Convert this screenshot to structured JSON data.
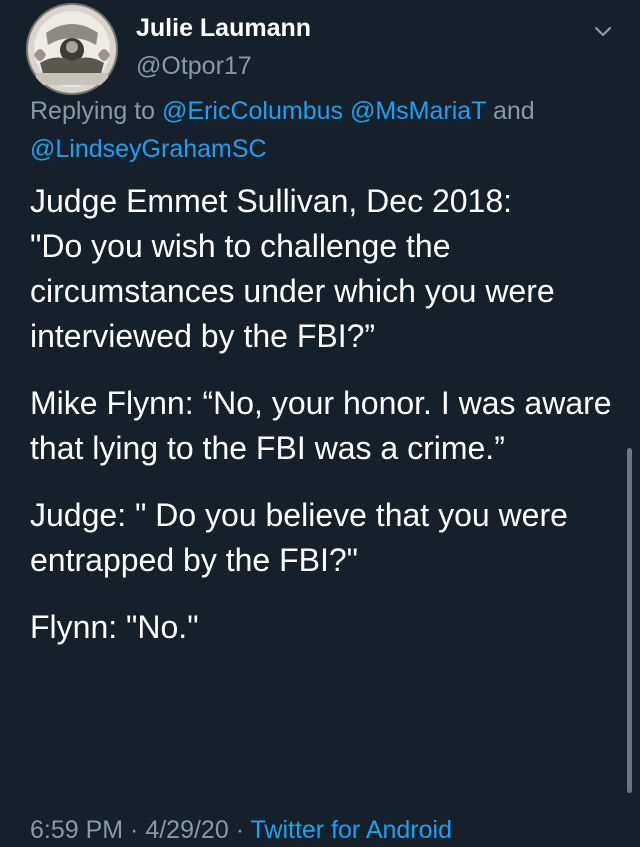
{
  "author": {
    "display_name": "Julie Laumann",
    "handle": "@Otpor17",
    "avatar_icon": "avatar-photo"
  },
  "menu_icon": "chevron-down-icon",
  "reply_context": {
    "prefix": "Replying to ",
    "mentions": [
      "@EricColumbus",
      "@MsMariaT",
      "@LindseyGrahamSC"
    ],
    "connector": " and "
  },
  "body": {
    "paragraphs": [
      "Judge Emmet Sullivan, Dec 2018:\n\"Do you wish to challenge the circumstances under which you were interviewed by the FBI?”",
      "Mike Flynn: “No, your honor. I was aware that lying to the FBI was a crime.”",
      "Judge: \" Do you believe that you were entrapped by the FBI?\"",
      "Flynn: \"No.\""
    ]
  },
  "footer": {
    "time": "6:59 PM",
    "separator": " · ",
    "date": "4/29/20",
    "source": "Twitter for Android"
  },
  "colors": {
    "background": "#15202b",
    "secondary_text": "#8899a6",
    "accent": "#1da1f2",
    "primary_text": "#ffffff"
  }
}
